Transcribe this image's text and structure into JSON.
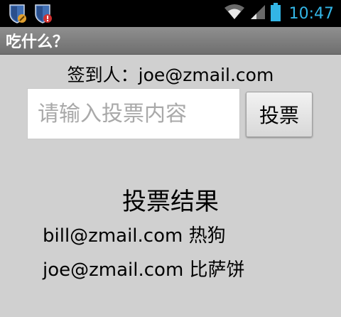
{
  "status_bar": {
    "time": "10:47",
    "icons": [
      "shield-wrench-icon",
      "shield-alert-icon",
      "wifi-icon",
      "signal-icon",
      "battery-icon"
    ]
  },
  "app": {
    "title": "吃什么？"
  },
  "checkin": {
    "text": "签到人：joe@zmail.com"
  },
  "vote": {
    "input_placeholder": "请输入投票内容",
    "input_value": "",
    "button_label": "投票"
  },
  "results": {
    "title": "投票结果",
    "items": [
      "bill@zmail.com 热狗",
      "joe@zmail.com 比萨饼"
    ]
  },
  "colors": {
    "status_time": "#33b5e5",
    "background": "#d0d0d0",
    "title_bar": "#7f7f7f"
  }
}
